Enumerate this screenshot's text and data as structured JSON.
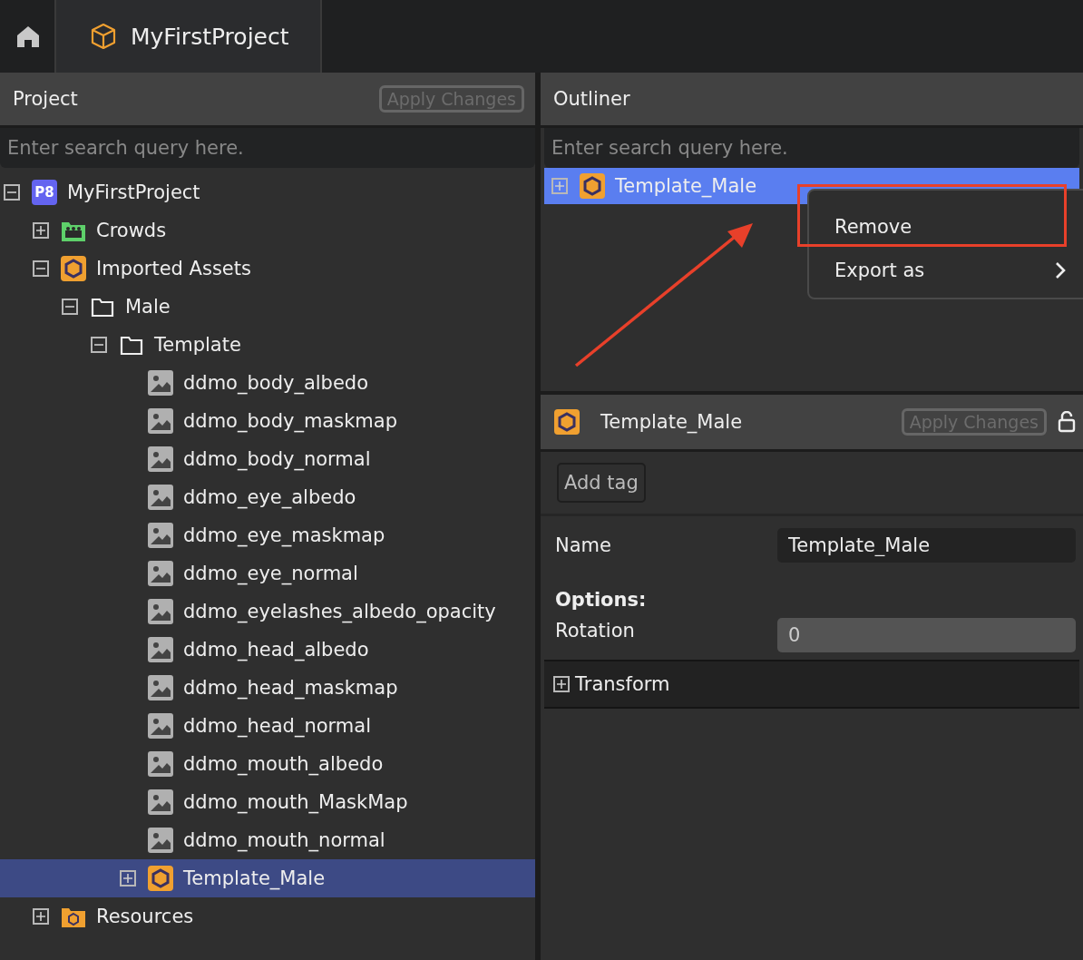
{
  "tabs": [
    {
      "kind": "home",
      "selected": false
    },
    {
      "kind": "project",
      "label": "MyFirstProject",
      "selected": true
    }
  ],
  "project_panel": {
    "title": "Project",
    "apply_button": "Apply Changes",
    "search": {
      "placeholder": "Enter search query here."
    },
    "tree": [
      {
        "kind": "project",
        "badge": "P8",
        "label": "MyFirstProject",
        "expanded": true,
        "selected": false,
        "children": [
          {
            "kind": "crowds",
            "label": "Crowds",
            "expanded": false,
            "selected": false
          },
          {
            "kind": "asset",
            "label": "Imported Assets",
            "expanded": true,
            "selected": false,
            "children": [
              {
                "kind": "folder",
                "label": "Male",
                "expanded": true,
                "selected": false,
                "children": [
                  {
                    "kind": "folder",
                    "label": "Template",
                    "expanded": true,
                    "selected": false,
                    "children": [
                      {
                        "kind": "image",
                        "label": "ddmo_body_albedo",
                        "selected": false
                      },
                      {
                        "kind": "image",
                        "label": "ddmo_body_maskmap",
                        "selected": false
                      },
                      {
                        "kind": "image",
                        "label": "ddmo_body_normal",
                        "selected": false
                      },
                      {
                        "kind": "image",
                        "label": "ddmo_eye_albedo",
                        "selected": false
                      },
                      {
                        "kind": "image",
                        "label": "ddmo_eye_maskmap",
                        "selected": false
                      },
                      {
                        "kind": "image",
                        "label": "ddmo_eye_normal",
                        "selected": false
                      },
                      {
                        "kind": "image",
                        "label": "ddmo_eyelashes_albedo_opacity",
                        "selected": false
                      },
                      {
                        "kind": "image",
                        "label": "ddmo_head_albedo",
                        "selected": false
                      },
                      {
                        "kind": "image",
                        "label": "ddmo_head_maskmap",
                        "selected": false
                      },
                      {
                        "kind": "image",
                        "label": "ddmo_head_normal",
                        "selected": false
                      },
                      {
                        "kind": "image",
                        "label": "ddmo_mouth_albedo",
                        "selected": false
                      },
                      {
                        "kind": "image",
                        "label": "ddmo_mouth_MaskMap",
                        "selected": false
                      },
                      {
                        "kind": "image",
                        "label": "ddmo_mouth_normal",
                        "selected": false
                      },
                      {
                        "kind": "asset",
                        "label": "Template_Male",
                        "expanded": false,
                        "selected": true
                      }
                    ]
                  }
                ]
              }
            ]
          },
          {
            "kind": "resources",
            "label": "Resources",
            "expanded": false,
            "selected": false
          }
        ]
      }
    ]
  },
  "outliner": {
    "title": "Outliner",
    "search": {
      "placeholder": "Enter search query here."
    },
    "items": [
      {
        "kind": "asset",
        "label": "Template_Male",
        "expanded": false,
        "selected": true
      }
    ],
    "context_menu": {
      "items": [
        {
          "label": "Remove",
          "submenu": false,
          "highlighted": true
        },
        {
          "label": "Export as",
          "submenu": true,
          "highlighted": false
        }
      ]
    }
  },
  "inspector": {
    "title": "Template_Male",
    "apply_button": "Apply Changes",
    "add_tag_button": "Add tag",
    "name_label": "Name",
    "name_value": "Template_Male",
    "options_heading": "Options:",
    "rotation_label": "Rotation",
    "rotation_value": "0",
    "sections": [
      {
        "label": "Transform",
        "expanded": false
      }
    ]
  }
}
